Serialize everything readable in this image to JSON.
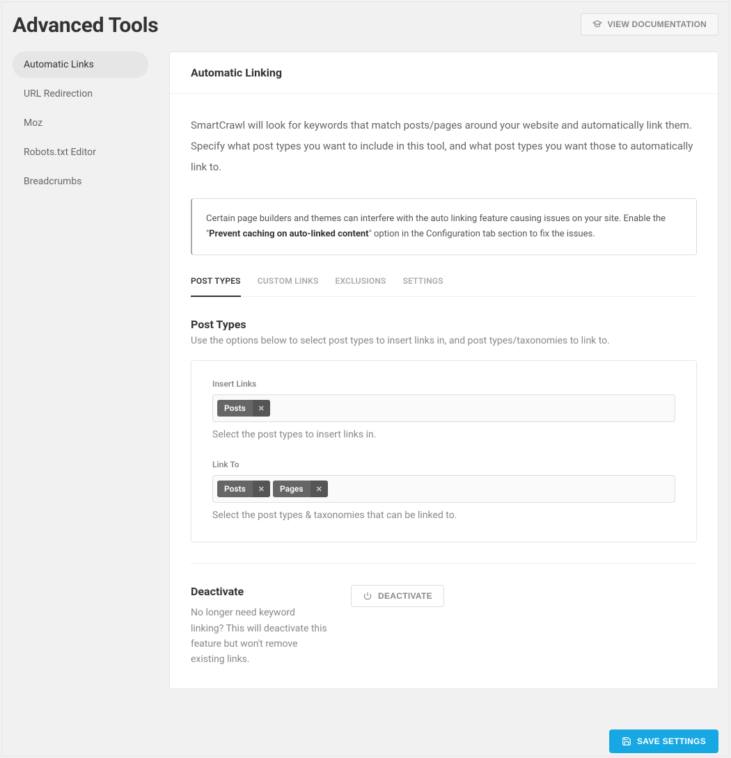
{
  "header": {
    "title": "Advanced Tools",
    "doc_button": "VIEW DOCUMENTATION"
  },
  "sidebar": {
    "items": [
      {
        "label": "Automatic Links",
        "active": true
      },
      {
        "label": "URL Redirection",
        "active": false
      },
      {
        "label": "Moz",
        "active": false
      },
      {
        "label": "Robots.txt Editor",
        "active": false
      },
      {
        "label": "Breadcrumbs",
        "active": false
      }
    ]
  },
  "panel": {
    "title": "Automatic Linking",
    "description": "SmartCrawl will look for keywords that match posts/pages around your website and automatically link them. Specify what post types you want to include in this tool, and what post types you want those to automatically link to.",
    "notice": {
      "before": "Certain page builders and themes can interfere with the auto linking feature causing issues on your site. Enable the \"",
      "bold": "Prevent caching on auto-linked content",
      "after": "\" option in the Configuration tab section to fix the issues."
    },
    "tabs": [
      {
        "label": "POST TYPES",
        "active": true
      },
      {
        "label": "CUSTOM LINKS",
        "active": false
      },
      {
        "label": "EXCLUSIONS",
        "active": false
      },
      {
        "label": "SETTINGS",
        "active": false
      }
    ],
    "post_types": {
      "title": "Post Types",
      "sub": "Use the options below to select post types to insert links in, and post types/taxonomies to link to.",
      "insert_links": {
        "label": "Insert Links",
        "tags": [
          "Posts"
        ],
        "help": "Select the post types to insert links in."
      },
      "link_to": {
        "label": "Link To",
        "tags": [
          "Posts",
          "Pages"
        ],
        "help": "Select the post types & taxonomies that can be linked to."
      }
    },
    "deactivate": {
      "title": "Deactivate",
      "desc": "No longer need keyword linking? This will deactivate this feature but won't remove existing links.",
      "button": "DEACTIVATE"
    }
  },
  "save": {
    "button": "SAVE SETTINGS"
  }
}
